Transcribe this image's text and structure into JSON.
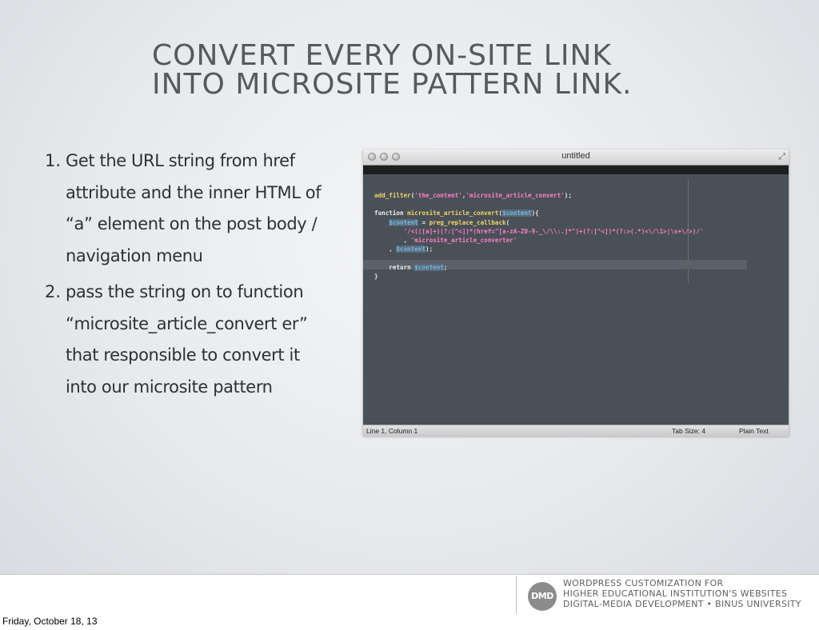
{
  "slide": {
    "title_line1": "Convert every on-site link",
    "title_line2": "into microsite pattern link.",
    "steps": [
      {
        "number": "1.",
        "text": "Get the URL string from href attribute and the inner HTML of “a” element on the post body / navigation menu"
      },
      {
        "number": "2.",
        "text": "pass the string on to function “microsite_article_convert er” that responsible to convert it into our microsite pattern"
      }
    ]
  },
  "editor": {
    "window_title": "untitled",
    "code_lines": [
      "add_filter('the_content','microsite_article_convert');",
      "",
      "function microsite_article_convert($content){",
      "    $content = preg_replace_callback(",
      "        '/<(([a]+)(?:[^<])*(href=\"[a-zA-Z0-9-_\\/\\\\:.]*\")+(?:[^<])*(?:>(.*)<\\/\\1>|\\s+\\/>)/'",
      "        , 'microsite_article_converter'",
      "    , $content);",
      "",
      "    return $content;",
      "}"
    ],
    "status_position": "Line 1, Column 1",
    "status_tab_size": "Tab Size: 4",
    "status_syntax": "Plain Text"
  },
  "footer": {
    "logo_text": "DMD",
    "line1": "Wordpress customization for",
    "line2": "higher educational institution's websites",
    "line3": "Digital-media development • Binus University"
  },
  "date_label": "Friday, October 18, 13"
}
